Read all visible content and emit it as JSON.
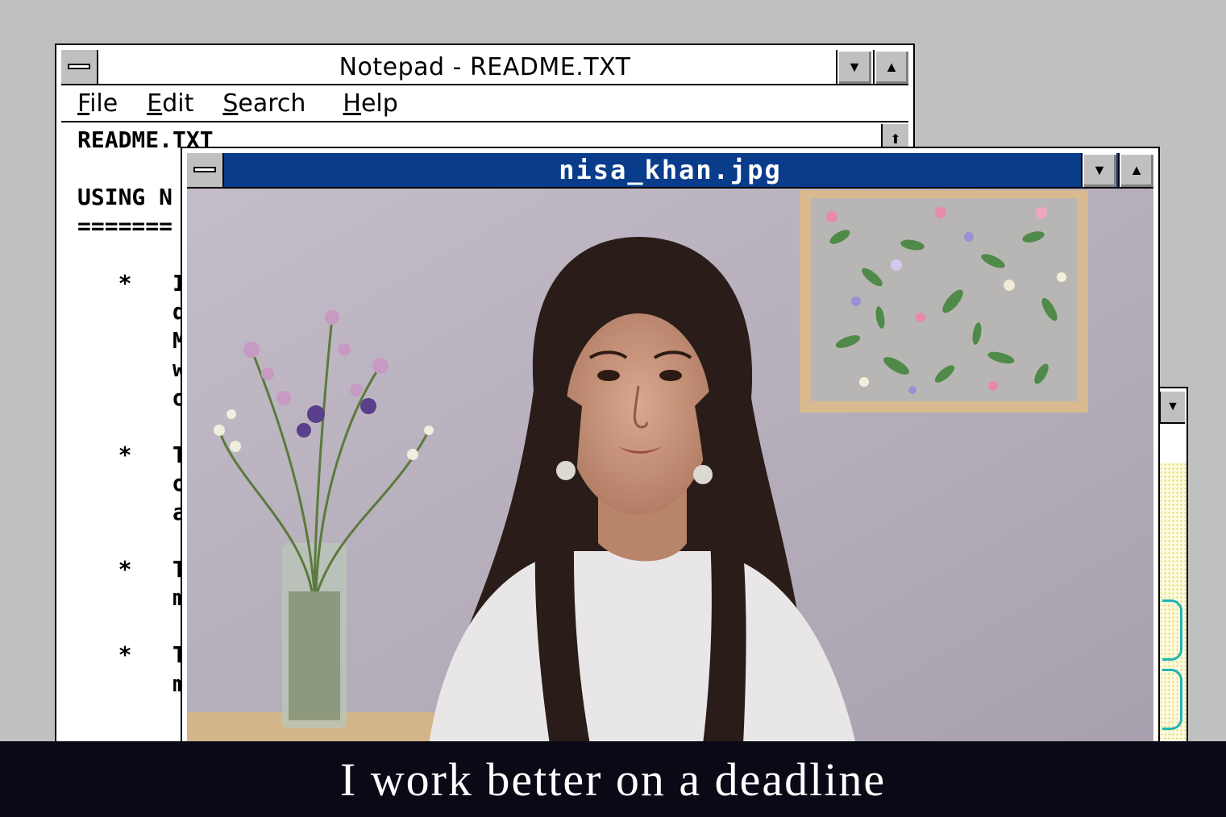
{
  "notepad": {
    "title": "Notepad - README.TXT",
    "menu": {
      "file": {
        "u": "F",
        "rest": "ile"
      },
      "edit": {
        "u": "E",
        "rest": "dit"
      },
      "search": {
        "u": "S",
        "rest": "earch"
      },
      "help": {
        "u": "H",
        "rest": "elp"
      }
    },
    "lines": [
      "README.TXT",
      "",
      "USING N",
      "=======",
      "",
      "   *   If",
      "       do",
      "       Ma",
      "       wi",
      "       of",
      "",
      "   *   To",
      "       or",
      "       al",
      "",
      "   *   To",
      "       me",
      "",
      "   *   To",
      "       me"
    ]
  },
  "viewer": {
    "title": "nisa_khan.jpg"
  },
  "caption": "I work better on a deadline",
  "colors": {
    "desktop": "#c0c0c0",
    "active_title": "#0a3c8c",
    "caption_bg": "#0a0a17"
  }
}
